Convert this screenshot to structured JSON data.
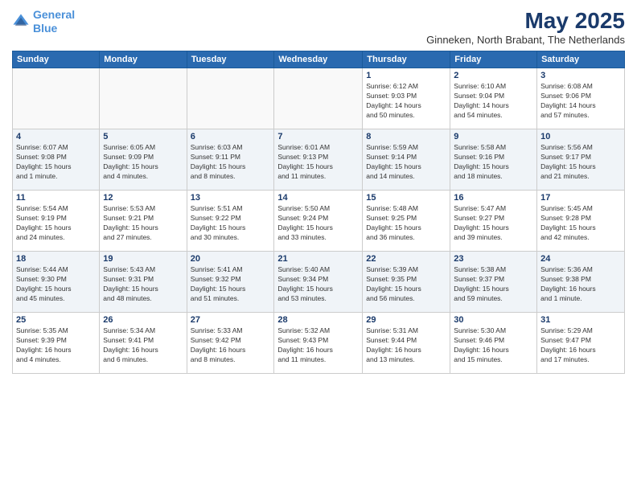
{
  "header": {
    "logo_line1": "General",
    "logo_line2": "Blue",
    "month": "May 2025",
    "location": "Ginneken, North Brabant, The Netherlands"
  },
  "weekdays": [
    "Sunday",
    "Monday",
    "Tuesday",
    "Wednesday",
    "Thursday",
    "Friday",
    "Saturday"
  ],
  "weeks": [
    [
      {
        "day": "",
        "info": ""
      },
      {
        "day": "",
        "info": ""
      },
      {
        "day": "",
        "info": ""
      },
      {
        "day": "",
        "info": ""
      },
      {
        "day": "1",
        "info": "Sunrise: 6:12 AM\nSunset: 9:03 PM\nDaylight: 14 hours\nand 50 minutes."
      },
      {
        "day": "2",
        "info": "Sunrise: 6:10 AM\nSunset: 9:04 PM\nDaylight: 14 hours\nand 54 minutes."
      },
      {
        "day": "3",
        "info": "Sunrise: 6:08 AM\nSunset: 9:06 PM\nDaylight: 14 hours\nand 57 minutes."
      }
    ],
    [
      {
        "day": "4",
        "info": "Sunrise: 6:07 AM\nSunset: 9:08 PM\nDaylight: 15 hours\nand 1 minute."
      },
      {
        "day": "5",
        "info": "Sunrise: 6:05 AM\nSunset: 9:09 PM\nDaylight: 15 hours\nand 4 minutes."
      },
      {
        "day": "6",
        "info": "Sunrise: 6:03 AM\nSunset: 9:11 PM\nDaylight: 15 hours\nand 8 minutes."
      },
      {
        "day": "7",
        "info": "Sunrise: 6:01 AM\nSunset: 9:13 PM\nDaylight: 15 hours\nand 11 minutes."
      },
      {
        "day": "8",
        "info": "Sunrise: 5:59 AM\nSunset: 9:14 PM\nDaylight: 15 hours\nand 14 minutes."
      },
      {
        "day": "9",
        "info": "Sunrise: 5:58 AM\nSunset: 9:16 PM\nDaylight: 15 hours\nand 18 minutes."
      },
      {
        "day": "10",
        "info": "Sunrise: 5:56 AM\nSunset: 9:17 PM\nDaylight: 15 hours\nand 21 minutes."
      }
    ],
    [
      {
        "day": "11",
        "info": "Sunrise: 5:54 AM\nSunset: 9:19 PM\nDaylight: 15 hours\nand 24 minutes."
      },
      {
        "day": "12",
        "info": "Sunrise: 5:53 AM\nSunset: 9:21 PM\nDaylight: 15 hours\nand 27 minutes."
      },
      {
        "day": "13",
        "info": "Sunrise: 5:51 AM\nSunset: 9:22 PM\nDaylight: 15 hours\nand 30 minutes."
      },
      {
        "day": "14",
        "info": "Sunrise: 5:50 AM\nSunset: 9:24 PM\nDaylight: 15 hours\nand 33 minutes."
      },
      {
        "day": "15",
        "info": "Sunrise: 5:48 AM\nSunset: 9:25 PM\nDaylight: 15 hours\nand 36 minutes."
      },
      {
        "day": "16",
        "info": "Sunrise: 5:47 AM\nSunset: 9:27 PM\nDaylight: 15 hours\nand 39 minutes."
      },
      {
        "day": "17",
        "info": "Sunrise: 5:45 AM\nSunset: 9:28 PM\nDaylight: 15 hours\nand 42 minutes."
      }
    ],
    [
      {
        "day": "18",
        "info": "Sunrise: 5:44 AM\nSunset: 9:30 PM\nDaylight: 15 hours\nand 45 minutes."
      },
      {
        "day": "19",
        "info": "Sunrise: 5:43 AM\nSunset: 9:31 PM\nDaylight: 15 hours\nand 48 minutes."
      },
      {
        "day": "20",
        "info": "Sunrise: 5:41 AM\nSunset: 9:32 PM\nDaylight: 15 hours\nand 51 minutes."
      },
      {
        "day": "21",
        "info": "Sunrise: 5:40 AM\nSunset: 9:34 PM\nDaylight: 15 hours\nand 53 minutes."
      },
      {
        "day": "22",
        "info": "Sunrise: 5:39 AM\nSunset: 9:35 PM\nDaylight: 15 hours\nand 56 minutes."
      },
      {
        "day": "23",
        "info": "Sunrise: 5:38 AM\nSunset: 9:37 PM\nDaylight: 15 hours\nand 59 minutes."
      },
      {
        "day": "24",
        "info": "Sunrise: 5:36 AM\nSunset: 9:38 PM\nDaylight: 16 hours\nand 1 minute."
      }
    ],
    [
      {
        "day": "25",
        "info": "Sunrise: 5:35 AM\nSunset: 9:39 PM\nDaylight: 16 hours\nand 4 minutes."
      },
      {
        "day": "26",
        "info": "Sunrise: 5:34 AM\nSunset: 9:41 PM\nDaylight: 16 hours\nand 6 minutes."
      },
      {
        "day": "27",
        "info": "Sunrise: 5:33 AM\nSunset: 9:42 PM\nDaylight: 16 hours\nand 8 minutes."
      },
      {
        "day": "28",
        "info": "Sunrise: 5:32 AM\nSunset: 9:43 PM\nDaylight: 16 hours\nand 11 minutes."
      },
      {
        "day": "29",
        "info": "Sunrise: 5:31 AM\nSunset: 9:44 PM\nDaylight: 16 hours\nand 13 minutes."
      },
      {
        "day": "30",
        "info": "Sunrise: 5:30 AM\nSunset: 9:46 PM\nDaylight: 16 hours\nand 15 minutes."
      },
      {
        "day": "31",
        "info": "Sunrise: 5:29 AM\nSunset: 9:47 PM\nDaylight: 16 hours\nand 17 minutes."
      }
    ]
  ]
}
